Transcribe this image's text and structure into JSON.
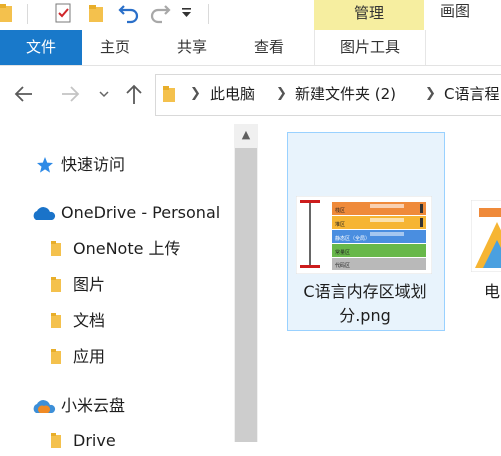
{
  "title_bar": {
    "manage_tab": "管理",
    "picture_tab": "画图"
  },
  "ribbon": {
    "file_tab": "文件",
    "tabs": [
      "主页",
      "共享",
      "查看"
    ],
    "contextual_tab": "图片工具"
  },
  "address_bar": {
    "crumbs": [
      "此电脑",
      "新建文件夹 (2)",
      "C语言程"
    ]
  },
  "navigation_pane": {
    "quick_access": "快速访问",
    "onedrive": "OneDrive - Personal",
    "onedrive_children": [
      "OneNote 上传",
      "图片",
      "文档",
      "应用"
    ],
    "mi_cloud": "小米云盘",
    "mi_cloud_children": [
      "Drive"
    ]
  },
  "files": [
    {
      "name": "C语言内存区域划分.png",
      "selected": true,
      "thumbnail_rows": [
        "栈区",
        "堆区",
        "静态区（全局）",
        "常量区",
        "代码区"
      ]
    },
    {
      "name": "电",
      "selected": false
    }
  ],
  "colors": {
    "file_tab": "#1979ca",
    "manage_highlight": "#f6eea0",
    "selection": "#e8f3fc",
    "selection_border": "#99d1ff",
    "onedrive_cloud": "#1a73c9",
    "mi_cloud": "#3d8fd8"
  }
}
